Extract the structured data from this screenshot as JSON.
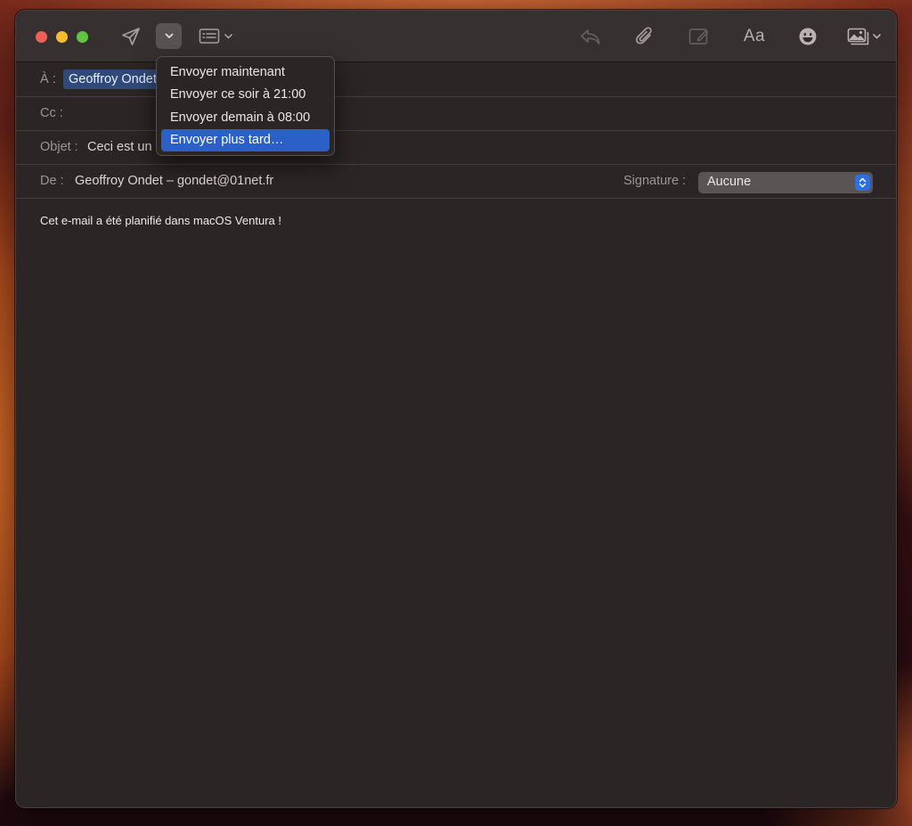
{
  "toolbar": {
    "icons": [
      "send-icon",
      "chevron-down-icon",
      "header-fields-icon",
      "reply-icon",
      "paperclip-icon",
      "markup-icon",
      "format-text-icon",
      "emoji-icon",
      "photo-browser-icon"
    ],
    "format_label": "Aa"
  },
  "compose": {
    "to_label": "À :",
    "to_value": "Geoffroy Ondet",
    "cc_label": "Cc :",
    "subject_label": "Objet :",
    "subject_value": "Ceci est un",
    "from_label": "De :",
    "from_value": "Geoffroy Ondet – gondet@01net.fr",
    "signature_label": "Signature :",
    "signature_value": "Aucune",
    "body": "Cet e-mail a été planifié dans macOS Ventura !"
  },
  "send_menu": {
    "items": [
      "Envoyer maintenant",
      "Envoyer ce soir à 21:00",
      "Envoyer demain à 08:00",
      "Envoyer plus tard…"
    ],
    "selected_index": 3
  },
  "colors": {
    "window_bg": "#2b2525",
    "toolbar_bg": "#363030",
    "accent": "#2b60c9",
    "close": "#ee5f57",
    "minimize": "#f5bd2e",
    "maximize": "#5fc63f"
  }
}
